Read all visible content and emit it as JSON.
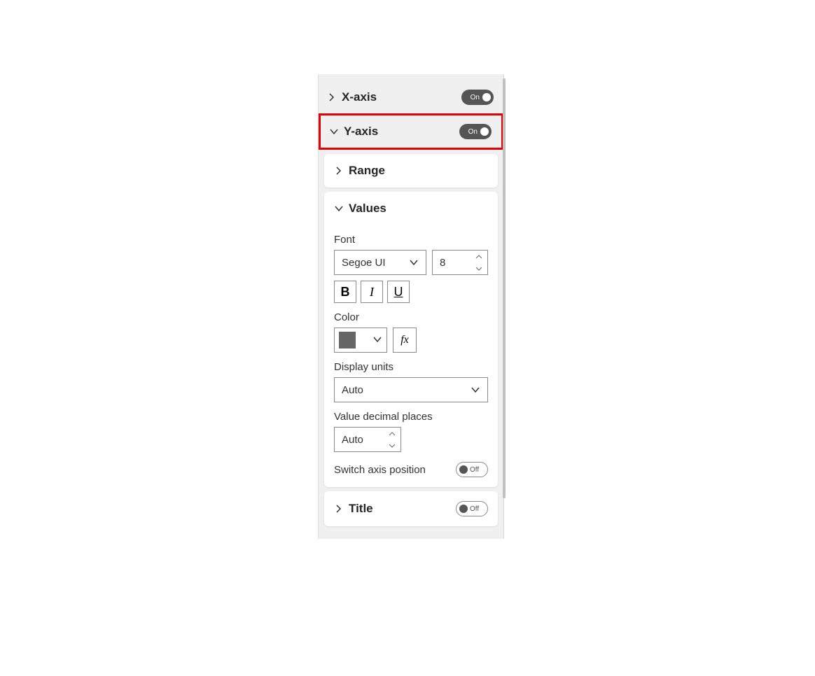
{
  "sections": {
    "xaxis": {
      "label": "X-axis",
      "toggle": "On"
    },
    "yaxis": {
      "label": "Y-axis",
      "toggle": "On"
    }
  },
  "range": {
    "label": "Range"
  },
  "values": {
    "label": "Values",
    "font_label": "Font",
    "font_value": "Segoe UI",
    "font_size": "8",
    "bold": "B",
    "italic": "I",
    "underline": "U",
    "color_label": "Color",
    "fx": "fx",
    "display_units_label": "Display units",
    "display_units_value": "Auto",
    "decimal_label": "Value decimal places",
    "decimal_value": "Auto",
    "switch_label": "Switch axis position",
    "switch_toggle": "Off"
  },
  "title": {
    "label": "Title",
    "toggle": "Off"
  }
}
